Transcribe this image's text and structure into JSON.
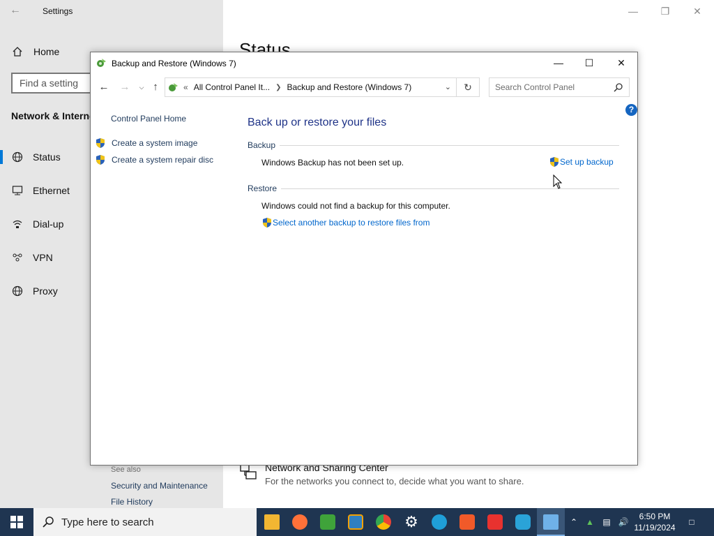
{
  "settings": {
    "title": "Settings",
    "home_label": "Home",
    "search_placeholder": "Find a setting",
    "section_title": "Network & Internet",
    "nav": [
      {
        "label": "Status",
        "icon": "globe-icon"
      },
      {
        "label": "Ethernet",
        "icon": "ethernet-icon"
      },
      {
        "label": "Dial-up",
        "icon": "dialup-icon"
      },
      {
        "label": "VPN",
        "icon": "vpn-icon"
      },
      {
        "label": "Proxy",
        "icon": "globe-icon"
      }
    ],
    "active_nav": "Status",
    "main_heading": "Status",
    "network_sharing": {
      "title": "Network and Sharing Center",
      "subtitle": "For the networks you connect to, decide what you want to share."
    }
  },
  "window": {
    "title": "Backup and Restore (Windows 7)",
    "address": {
      "overflow": "«",
      "crumbs": [
        "All Control Panel It...",
        "Backup and Restore (Windows 7)"
      ]
    },
    "search_placeholder": "Search Control Panel",
    "help_label": "?",
    "sidebar": {
      "home": "Control Panel Home",
      "items": [
        "Create a system image",
        "Create a system repair disc"
      ],
      "see_also_label": "See also",
      "see_also": [
        "Security and Maintenance",
        "File History"
      ]
    },
    "main": {
      "heading": "Back up or restore your files",
      "backup": {
        "label": "Backup",
        "message": "Windows Backup has not been set up.",
        "action": "Set up backup"
      },
      "restore": {
        "label": "Restore",
        "message": "Windows could not find a backup for this computer.",
        "action": "Select another backup to restore files from"
      }
    }
  },
  "taskbar": {
    "search_placeholder": "Type here to search",
    "apps": [
      "file-explorer",
      "firefox",
      "people",
      "virtualbox",
      "chrome",
      "settings",
      "edge",
      "brave",
      "anydesk",
      "ccleaner",
      "control-panel"
    ],
    "clock": {
      "time": "6:50 PM",
      "date": "11/19/2024"
    }
  },
  "colors": {
    "accent": "#0078d7",
    "link": "#0066cc",
    "heading": "#1e3287",
    "taskbar": "#1f3551"
  }
}
